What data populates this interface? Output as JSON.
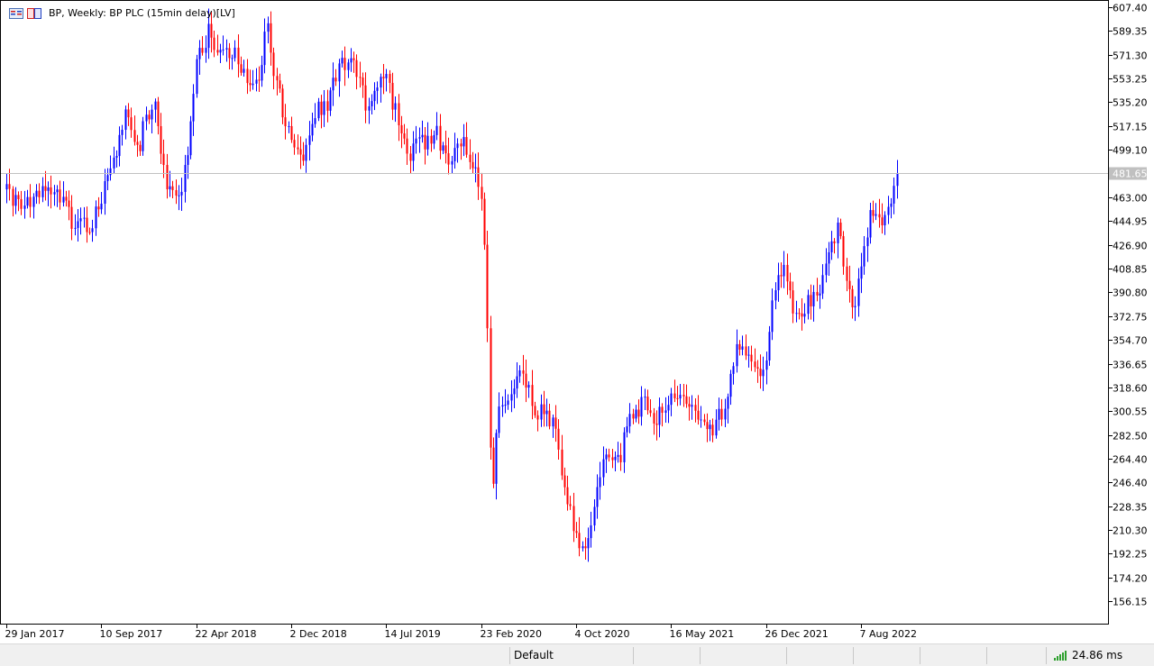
{
  "chart_title": "BP, Weekly:  BP PLC (15min delay)[LV]",
  "chart_data": {
    "type": "candlestick",
    "title": "BP, Weekly:  BP PLC (15min delay)[LV]",
    "timeframe": "Weekly",
    "ylim": [
      138.5,
      607.4
    ],
    "y_ticks": [
      "607.40",
      "589.35",
      "571.30",
      "553.25",
      "535.20",
      "517.15",
      "499.10",
      "463.00",
      "444.95",
      "426.90",
      "408.85",
      "390.80",
      "372.75",
      "354.70",
      "336.65",
      "318.60",
      "300.55",
      "282.50",
      "264.40",
      "246.40",
      "228.35",
      "210.30",
      "192.25",
      "174.20",
      "156.15"
    ],
    "x_labels": [
      "29 Jan 2017",
      "10 Sep 2017",
      "22 Apr 2018",
      "2 Dec 2018",
      "14 Jul 2019",
      "23 Feb 2020",
      "4 Oct 2020",
      "16 May 2021",
      "26 Dec 2021",
      "7 Aug 2022"
    ],
    "current_price": "481.65",
    "bull_color": "#0000ff",
    "bear_color": "#ff0000",
    "grid": false,
    "anchors": [
      [
        "2017-01-29",
        468
      ],
      [
        "2017-03-15",
        455
      ],
      [
        "2017-05-10",
        470
      ],
      [
        "2017-07-01",
        447
      ],
      [
        "2017-08-15",
        440
      ],
      [
        "2017-10-01",
        480
      ],
      [
        "2017-11-05",
        525
      ],
      [
        "2017-12-10",
        505
      ],
      [
        "2018-01-10",
        540
      ],
      [
        "2018-02-10",
        470
      ],
      [
        "2018-03-10",
        462
      ],
      [
        "2018-03-31",
        492
      ],
      [
        "2018-04-22",
        565
      ],
      [
        "2018-05-20",
        590
      ],
      [
        "2018-06-20",
        570
      ],
      [
        "2018-07-20",
        575
      ],
      [
        "2018-08-20",
        555
      ],
      [
        "2018-09-15",
        550
      ],
      [
        "2018-10-07",
        598
      ],
      [
        "2018-10-28",
        545
      ],
      [
        "2018-12-02",
        510
      ],
      [
        "2018-12-28",
        490
      ],
      [
        "2019-01-25",
        525
      ],
      [
        "2019-02-25",
        535
      ],
      [
        "2019-03-25",
        560
      ],
      [
        "2019-04-20",
        575
      ],
      [
        "2019-05-25",
        535
      ],
      [
        "2019-06-25",
        545
      ],
      [
        "2019-07-14",
        555
      ],
      [
        "2019-08-10",
        520
      ],
      [
        "2019-09-05",
        495
      ],
      [
        "2019-10-01",
        505
      ],
      [
        "2019-11-10",
        510
      ],
      [
        "2019-12-10",
        485
      ],
      [
        "2020-01-05",
        505
      ],
      [
        "2020-02-01",
        490
      ],
      [
        "2020-02-23",
        465
      ],
      [
        "2020-03-05",
        405
      ],
      [
        "2020-03-15",
        265
      ],
      [
        "2020-03-22",
        245
      ],
      [
        "2020-04-01",
        305
      ],
      [
        "2020-05-01",
        310
      ],
      [
        "2020-06-01",
        330
      ],
      [
        "2020-07-01",
        300
      ],
      [
        "2020-08-10",
        295
      ],
      [
        "2020-09-10",
        240
      ],
      [
        "2020-10-01",
        205
      ],
      [
        "2020-10-25",
        193
      ],
      [
        "2020-11-20",
        245
      ],
      [
        "2020-12-15",
        270
      ],
      [
        "2021-01-10",
        260
      ],
      [
        "2021-02-10",
        300
      ],
      [
        "2021-03-10",
        305
      ],
      [
        "2021-04-10",
        295
      ],
      [
        "2021-05-16",
        315
      ],
      [
        "2021-06-15",
        310
      ],
      [
        "2021-07-15",
        295
      ],
      [
        "2021-08-15",
        285
      ],
      [
        "2021-09-15",
        300
      ],
      [
        "2021-10-15",
        350
      ],
      [
        "2021-11-15",
        335
      ],
      [
        "2021-12-10",
        328
      ],
      [
        "2021-12-26",
        345
      ],
      [
        "2022-01-15",
        395
      ],
      [
        "2022-02-10",
        410
      ],
      [
        "2022-03-01",
        370
      ],
      [
        "2022-03-20",
        380
      ],
      [
        "2022-04-20",
        385
      ],
      [
        "2022-05-25",
        425
      ],
      [
        "2022-06-15",
        440
      ],
      [
        "2022-07-05",
        390
      ],
      [
        "2022-07-25",
        375
      ],
      [
        "2022-08-07",
        415
      ],
      [
        "2022-09-01",
        455
      ],
      [
        "2022-09-25",
        440
      ],
      [
        "2022-10-15",
        462
      ],
      [
        "2022-11-05",
        482
      ]
    ]
  },
  "status_bar": {
    "profile": "Default",
    "ping": "24.86 ms"
  }
}
